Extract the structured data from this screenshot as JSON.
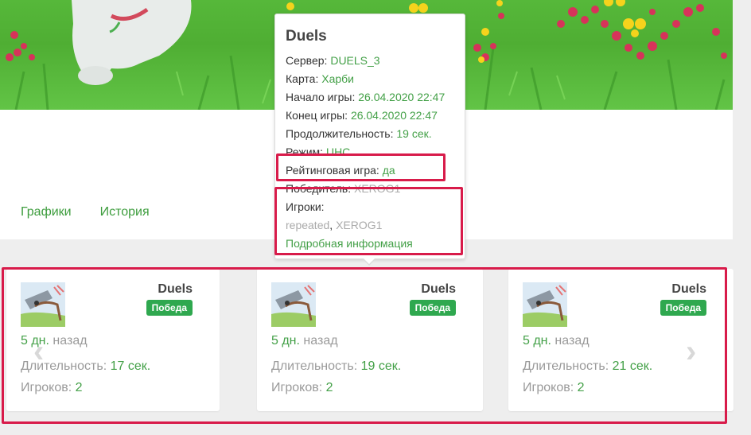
{
  "tabs": [
    {
      "label": "Графики"
    },
    {
      "label": "История"
    }
  ],
  "tooltip": {
    "title": "Duels",
    "server_label": "Сервер:",
    "server_value": "DUELS_3",
    "map_label": "Карта:",
    "map_value": "Харби",
    "start_label": "Начало игры:",
    "start_value": "26.04.2020 22:47",
    "end_label": "Конец игры:",
    "end_value": "26.04.2020 22:47",
    "duration_label": "Продолжительность:",
    "duration_value": "19 сек.",
    "mode_label": "Режим:",
    "mode_value": "UHC",
    "ranked_label": "Рейтинговая игра:",
    "ranked_value": "да",
    "winner_label": "Победитель:",
    "winner_value": "XEROG1",
    "players_label": "Игроки:",
    "player_1": "repeated",
    "separator": ",",
    "player_2": "XEROG1",
    "details_link": "Подробная информация"
  },
  "cards": [
    {
      "title": "Duels",
      "badge": "Победа",
      "ago_value": "5 дн.",
      "ago_suffix": "назад",
      "duration_label": "Длительность:",
      "duration_value": "17 сек.",
      "players_label": "Игроков:",
      "players_value": "2"
    },
    {
      "title": "Duels",
      "badge": "Победа",
      "ago_value": "5 дн.",
      "ago_suffix": "назад",
      "duration_label": "Длительность:",
      "duration_value": "19 сек.",
      "players_label": "Игроков:",
      "players_value": "2"
    },
    {
      "title": "Duels",
      "badge": "Победа",
      "ago_value": "5 дн.",
      "ago_suffix": "назад",
      "duration_label": "Длительность:",
      "duration_value": "21 сек.",
      "players_label": "Игроков:",
      "players_value": "2"
    }
  ],
  "nav": {
    "prev_icon": "chevron-left-icon",
    "next_icon": "chevron-right-icon"
  },
  "colors": {
    "accent_green": "#43a047",
    "badge_green": "#2fa84f",
    "highlight_red": "#d81b4a"
  }
}
